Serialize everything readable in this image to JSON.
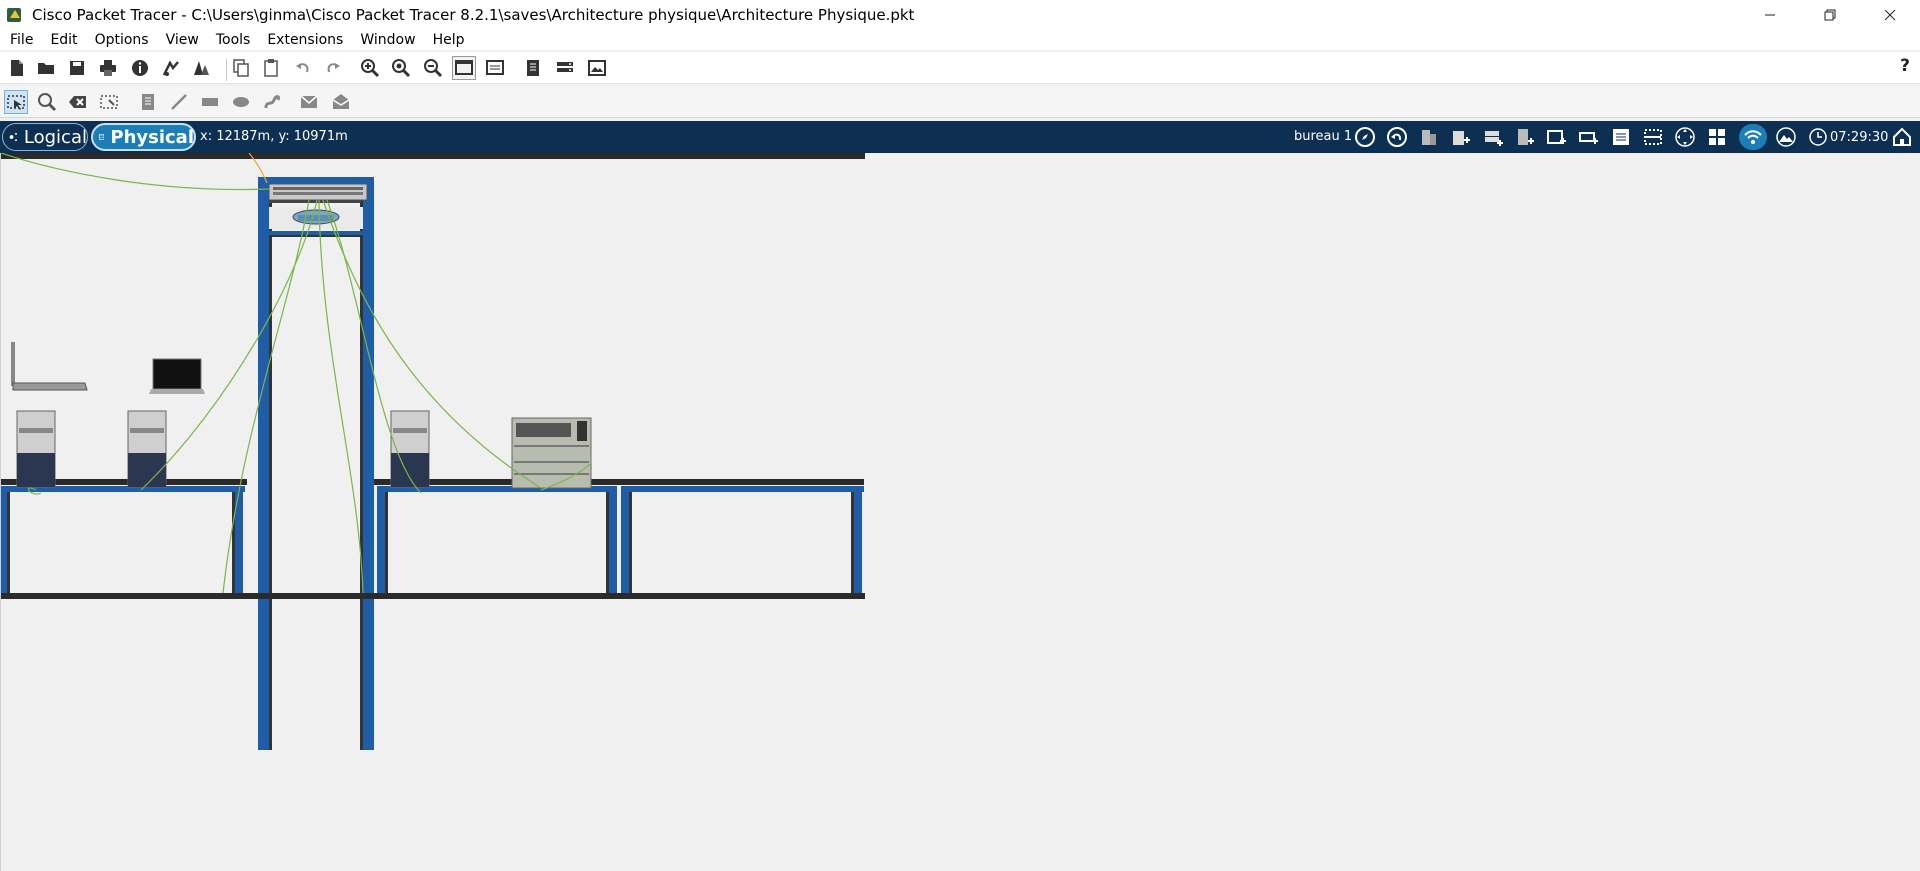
{
  "window": {
    "title": "Cisco Packet Tracer - C:\\Users\\ginma\\Cisco Packet Tracer 8.2.1\\saves\\Architecture physique\\Architecture Physique.pkt",
    "controls": [
      "minimize-icon",
      "restore-icon",
      "close-icon"
    ]
  },
  "menu": {
    "items": [
      "File",
      "Edit",
      "Options",
      "View",
      "Tools",
      "Extensions",
      "Window",
      "Help"
    ]
  },
  "toolbar_main": {
    "icons": [
      "new-file-icon",
      "open-folder-icon",
      "save-icon",
      "print-icon",
      "info-icon",
      "activity-wizard-icon",
      "custom-device-icon",
      "copy-icon",
      "paste-icon",
      "undo-icon",
      "redo-icon",
      "zoom-in-icon",
      "zoom-reset-icon",
      "zoom-out-icon",
      "drawing-palette-icon",
      "custom-devices-dialog-icon",
      "view-command-log-icon",
      "network-info-icon",
      "viewport-icon"
    ],
    "help": "?"
  },
  "toolbar_tools": {
    "icons": [
      "select-icon",
      "inspect-icon",
      "delete-icon",
      "resize-icon",
      "place-note-icon",
      "draw-line-icon",
      "draw-rectangle-icon",
      "draw-ellipse-icon",
      "freeform-icon",
      "add-simple-pdu-icon",
      "add-complex-pdu-icon"
    ]
  },
  "navigation": {
    "logical_label": "Logical",
    "physical_label": "Physical",
    "coordinates": "x: 12187m, y: 10971m",
    "location": "bureau 1",
    "time": "07:29:30",
    "icons": [
      "navigation-icon",
      "back-icon",
      "new-building-icon",
      "new-floor-icon",
      "new-rack-icon",
      "new-closet-icon",
      "new-table-icon",
      "move-object-icon",
      "grid-icon",
      "wiring-closet-icon",
      "zoom-fit-icon",
      "pan-icon",
      "tile-view-icon",
      "wireless-icon",
      "background-image-icon",
      "clock-icon",
      "home-icon"
    ]
  },
  "colors": {
    "navbar_bg": "#0d2f52",
    "physical_active": "#1c7eb7",
    "rack_blue": "#1f5da8",
    "shelf_black": "#2a2a2a",
    "cable_green": "#7ab648",
    "cable_orange": "#e8a33a"
  }
}
